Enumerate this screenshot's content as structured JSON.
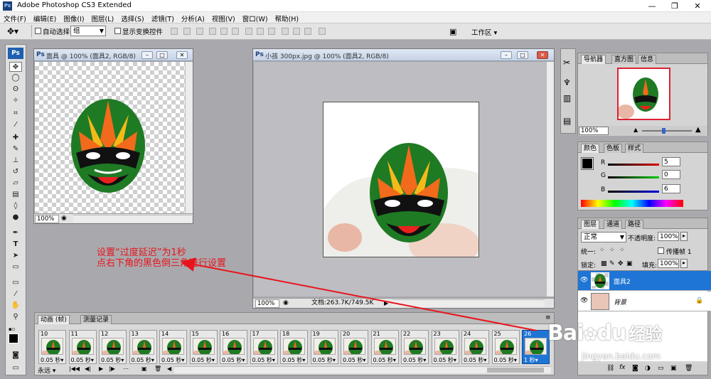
{
  "app": {
    "title": "Adobe Photoshop CS3 Extended",
    "logo": "Ps"
  },
  "menu": [
    "文件(F)",
    "编辑(E)",
    "图像(I)",
    "图层(L)",
    "选择(S)",
    "滤镜(T)",
    "分析(A)",
    "视图(V)",
    "窗口(W)",
    "帮助(H)"
  ],
  "options": {
    "auto_select_label": "自动选择:",
    "auto_select_value": "组",
    "show_transform_label": "显示变换控件",
    "workspace_label": "工作区"
  },
  "doc1": {
    "title": "面具 @ 100% (面具2, RGB/8)",
    "zoom": "100%"
  },
  "doc2": {
    "title": "小孩 300px.jpg @ 100% (面具2, RGB/8)",
    "zoom": "100%",
    "doc_info": "文档:263.7K/749.5K"
  },
  "navigator": {
    "tabs": [
      "导航器",
      "直方图",
      "信息"
    ],
    "zoom": "100%"
  },
  "color_panel": {
    "tabs": [
      "颜色",
      "色板",
      "样式"
    ],
    "r_label": "R",
    "g_label": "G",
    "b_label": "B",
    "r": "5",
    "g": "0",
    "b": "6"
  },
  "layers_panel": {
    "tabs": [
      "图层",
      "通道",
      "路径"
    ],
    "blend_mode": "正常",
    "opacity_label": "不透明度:",
    "opacity": "100%",
    "unify_label": "统一:",
    "propagate_label": "传播帧 1",
    "lock_label": "锁定:",
    "fill_label": "填充:",
    "fill": "100%",
    "layers": [
      {
        "name": "面具2",
        "selected": true
      },
      {
        "name": "背景",
        "selected": false
      }
    ]
  },
  "animation": {
    "tabs": [
      "动画 (帧)",
      "测量记录"
    ],
    "loop": "永远",
    "frames": [
      {
        "num": "10",
        "delay": "0.05 秒"
      },
      {
        "num": "11",
        "delay": "0.05 秒"
      },
      {
        "num": "12",
        "delay": "0.05 秒"
      },
      {
        "num": "13",
        "delay": "0.05 秒"
      },
      {
        "num": "14",
        "delay": "0.05 秒"
      },
      {
        "num": "15",
        "delay": "0.05 秒"
      },
      {
        "num": "16",
        "delay": "0.05 秒"
      },
      {
        "num": "17",
        "delay": "0.05 秒"
      },
      {
        "num": "18",
        "delay": "0.05 秒"
      },
      {
        "num": "19",
        "delay": "0.05 秒"
      },
      {
        "num": "20",
        "delay": "0.05 秒"
      },
      {
        "num": "21",
        "delay": "0.05 秒"
      },
      {
        "num": "22",
        "delay": "0.05 秒"
      },
      {
        "num": "23",
        "delay": "0.05 秒"
      },
      {
        "num": "24",
        "delay": "0.05 秒"
      },
      {
        "num": "25",
        "delay": "0.05 秒"
      },
      {
        "num": "26",
        "delay": "1 秒",
        "active": true
      }
    ]
  },
  "annotation": {
    "line1": "设置“过度延迟”为1秒",
    "line2": "点右下角的黑色倒三角进行设置"
  },
  "watermark": {
    "brand": "Bai",
    "brand2": "du",
    "cn": "经验",
    "url": "jingyan.baidu.com"
  },
  "colors": {
    "accent": "#1f75d6",
    "annotation": "#e8141c",
    "mask_green": "#1f7a24",
    "mask_orange": "#f26a1b"
  }
}
